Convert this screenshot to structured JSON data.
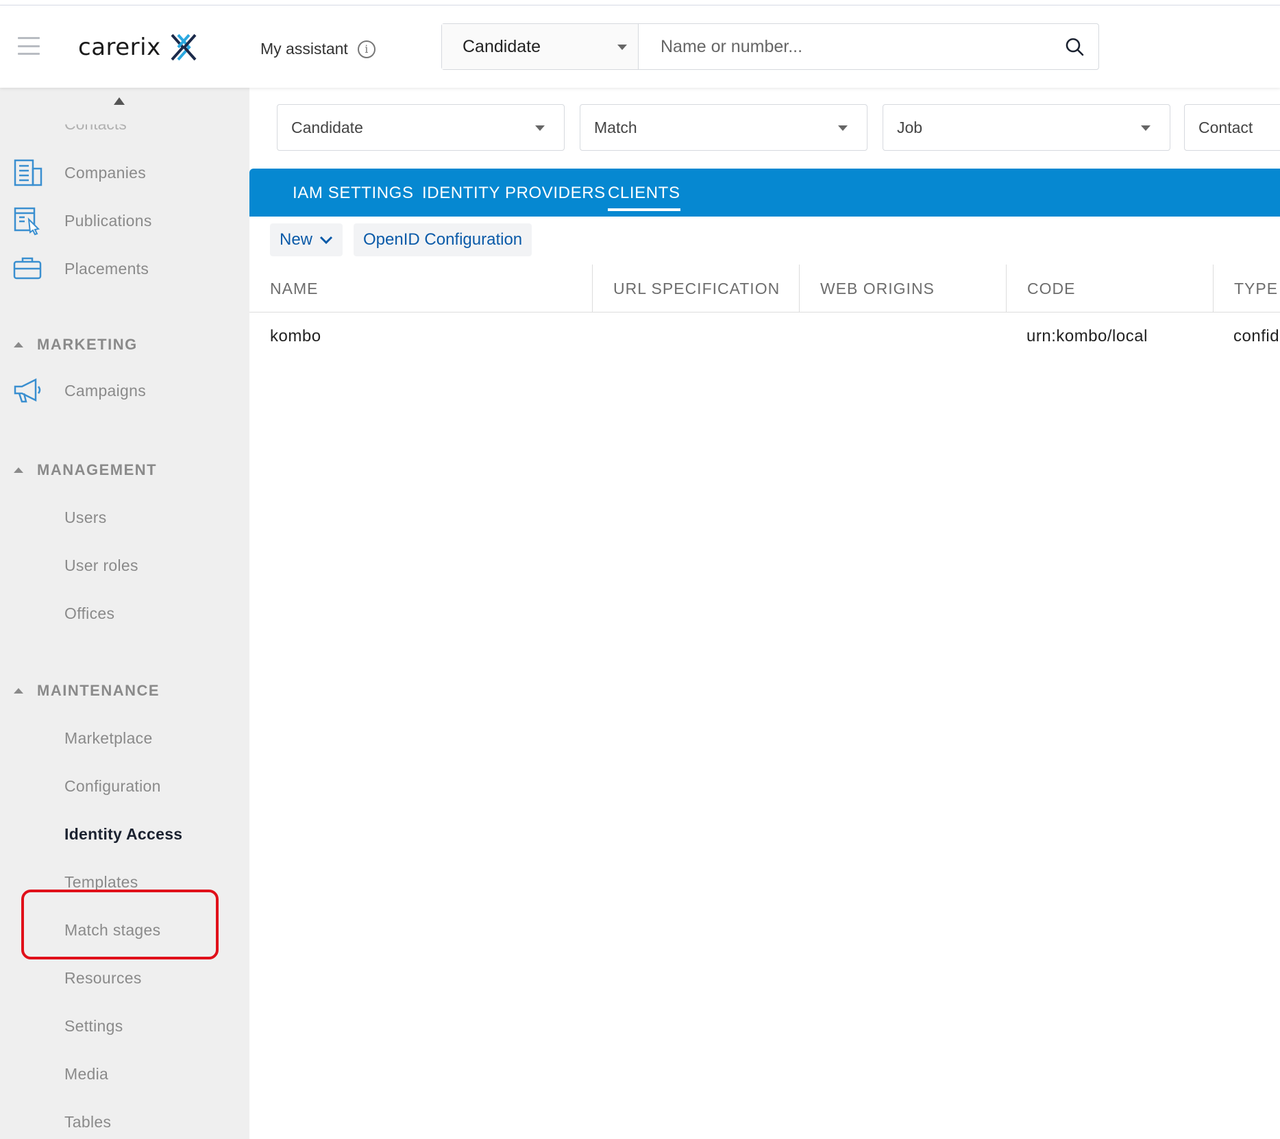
{
  "header": {
    "logo_text": "carerix",
    "assistant_label": "My assistant",
    "search": {
      "type_value": "Candidate",
      "placeholder": "Name or number..."
    }
  },
  "sidebar": {
    "partial_label": "Contacts",
    "items_top": [
      {
        "label": "Companies",
        "icon": "companies-icon"
      },
      {
        "label": "Publications",
        "icon": "publications-icon"
      },
      {
        "label": "Placements",
        "icon": "placements-icon"
      }
    ],
    "marketing": {
      "title": "MARKETING",
      "items": [
        {
          "label": "Campaigns",
          "icon": "megaphone-icon"
        }
      ]
    },
    "management": {
      "title": "MANAGEMENT",
      "items": [
        {
          "label": "Users"
        },
        {
          "label": "User roles"
        },
        {
          "label": "Offices"
        }
      ]
    },
    "maintenance": {
      "title": "MAINTENANCE",
      "items": [
        {
          "label": "Marketplace"
        },
        {
          "label": "Configuration"
        },
        {
          "label": "Identity Access",
          "active": true
        },
        {
          "label": "Templates"
        },
        {
          "label": "Match stages"
        },
        {
          "label": "Resources"
        },
        {
          "label": "Settings"
        },
        {
          "label": "Media"
        },
        {
          "label": "Tables"
        }
      ]
    },
    "highlight_color": "#e0101a"
  },
  "filters": [
    "Candidate",
    "Match",
    "Job",
    "Contact"
  ],
  "tabs": [
    {
      "label": "IAM SETTINGS"
    },
    {
      "label": "IDENTITY PROVIDERS"
    },
    {
      "label": "CLIENTS",
      "active": true
    }
  ],
  "toolbar": {
    "new_label": "New",
    "openid_label": "OpenID Configuration"
  },
  "table": {
    "columns": [
      "NAME",
      "URL SPECIFICATION",
      "WEB ORIGINS",
      "CODE",
      "TYPE"
    ],
    "rows": [
      {
        "name": "kombo",
        "url_specification": "",
        "web_origins": "",
        "code": "urn:kombo/local",
        "type": "confidential"
      }
    ]
  },
  "colors": {
    "accent": "#0688d1",
    "link": "#0a5aa8",
    "sidebar_bg": "#efefef",
    "logo_x_dark": "#1b2a4a",
    "logo_x_light": "#2aa8e0"
  }
}
